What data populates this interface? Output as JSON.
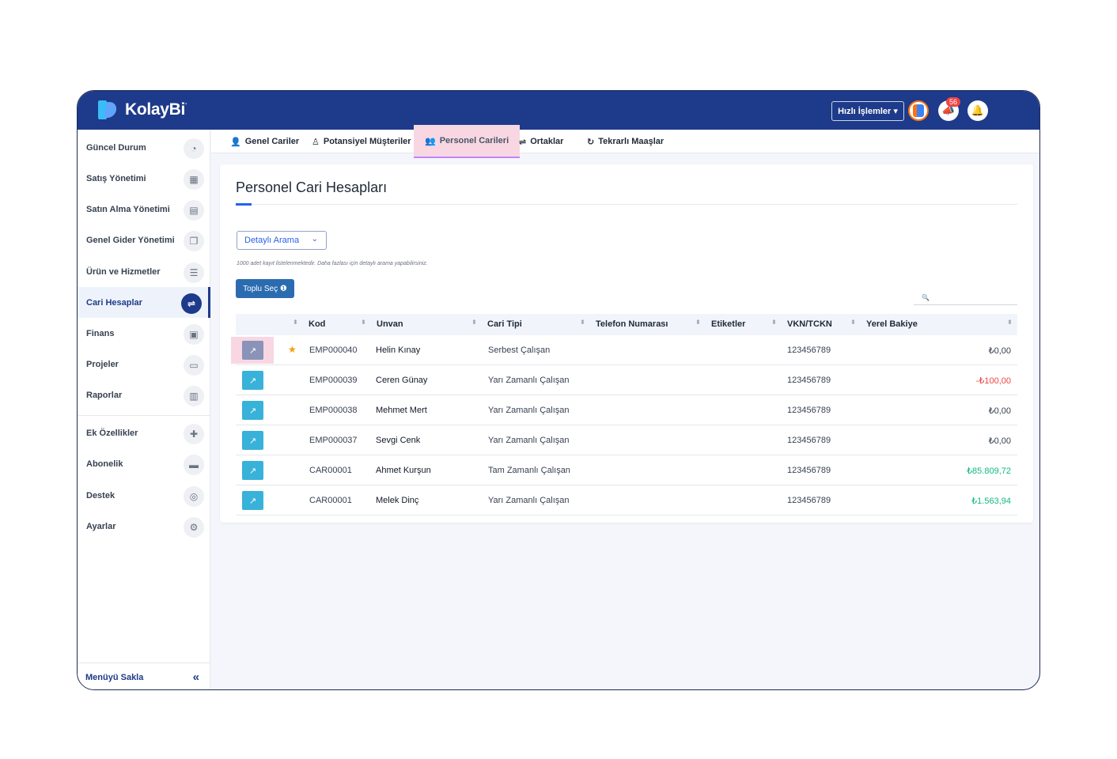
{
  "brand": {
    "name": "KolayBi",
    "mark": "'"
  },
  "topbar": {
    "quick_actions": "Hızlı İşlemler ▾",
    "notice_badge": "56"
  },
  "sidebar": {
    "items": [
      {
        "label": "Güncel Durum",
        "icon": "dashboard-icon"
      },
      {
        "label": "Satış Yönetimi",
        "icon": "calculator-icon"
      },
      {
        "label": "Satın Alma Yönetimi",
        "icon": "document-icon"
      },
      {
        "label": "Genel Gider Yönetimi",
        "icon": "copy-icon"
      },
      {
        "label": "Ürün ve Hizmetler",
        "icon": "database-icon"
      },
      {
        "label": "Cari Hesaplar",
        "icon": "handshake-icon",
        "active": true
      },
      {
        "label": "Finans",
        "icon": "money-icon"
      },
      {
        "label": "Projeler",
        "icon": "folder-icon"
      },
      {
        "label": "Raporlar",
        "icon": "chart-icon"
      },
      {
        "label": "Ek Özellikler",
        "icon": "puzzle-icon"
      },
      {
        "label": "Abonelik",
        "icon": "card-icon"
      },
      {
        "label": "Destek",
        "icon": "support-icon"
      },
      {
        "label": "Ayarlar",
        "icon": "gears-icon"
      }
    ],
    "footer": "Menüyü Sakla"
  },
  "tabs": [
    {
      "label": "Genel Cariler",
      "icon": "user-icon"
    },
    {
      "label": "Potansiyel Müşteriler",
      "icon": "user-outline-icon"
    },
    {
      "label": "Personel Carileri",
      "icon": "users-icon",
      "active": true
    },
    {
      "label": "Ortaklar",
      "icon": "handshake-icon"
    },
    {
      "label": "Tekrarlı Maaşlar",
      "icon": "refresh-icon"
    }
  ],
  "page": {
    "title": "Personel Cari Hesapları",
    "detail_search": "Detaylı Arama",
    "note": "1000 adet kayıt listelenmektedir. Daha fazlası için detaylı arama yapabilirsiniz.",
    "bulk_select": "Toplu Seç ❶"
  },
  "table": {
    "columns": [
      "Kod",
      "Unvan",
      "Cari Tipi",
      "Telefon Numarası",
      "Etiketler",
      "VKN/TCKN",
      "Yerel Bakiye"
    ],
    "rows": [
      {
        "kod": "EMP000040",
        "unvan": "Helin Kınay",
        "tip": "Serbest Çalışan",
        "vkn": "123456789",
        "bakiye": "₺0,00",
        "tone": "neutral",
        "starred": true
      },
      {
        "kod": "EMP000039",
        "unvan": "Ceren Günay",
        "tip": "Yarı Zamanlı Çalışan",
        "vkn": "123456789",
        "bakiye": "-₺100,00",
        "tone": "negative"
      },
      {
        "kod": "EMP000038",
        "unvan": "Mehmet Mert",
        "tip": "Yarı Zamanlı Çalışan",
        "vkn": "123456789",
        "bakiye": "₺0,00",
        "tone": "neutral"
      },
      {
        "kod": "EMP000037",
        "unvan": "Sevgi Cenk",
        "tip": "Yarı Zamanlı Çalışan",
        "vkn": "123456789",
        "bakiye": "₺0,00",
        "tone": "neutral"
      },
      {
        "kod": "CAR00001",
        "unvan": "Ahmet Kurşun",
        "tip": "Tam Zamanlı Çalışan",
        "vkn": "123456789",
        "bakiye": "₺85.809,72",
        "tone": "positive"
      },
      {
        "kod": "CAR00001",
        "unvan": "Melek Dinç",
        "tip": "Yarı Zamanlı Çalışan",
        "vkn": "123456789",
        "bakiye": "₺1.563,94",
        "tone": "positive"
      }
    ]
  },
  "colors": {
    "primary": "#1e3a8a",
    "negative": "#ef4444",
    "positive": "#10b981",
    "neutral": "#374151"
  }
}
